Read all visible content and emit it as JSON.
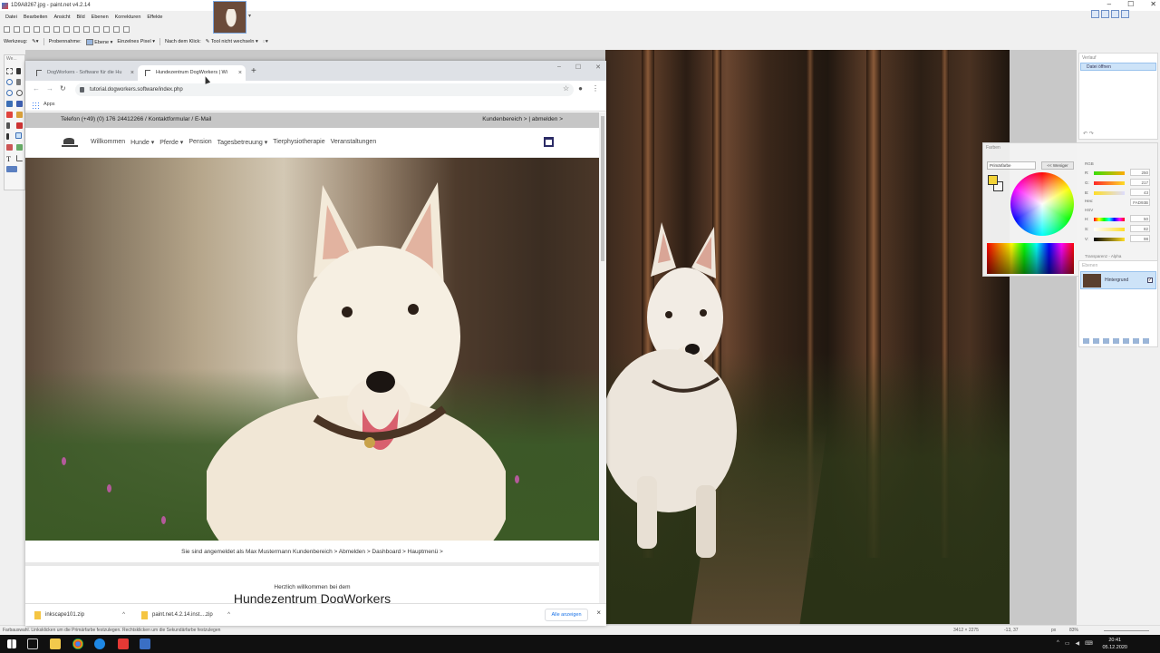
{
  "pn": {
    "title": "1D9A8267.jpg - paint.net v4.2.14",
    "menu": [
      "Datei",
      "Bearbeiten",
      "Ansicht",
      "Bild",
      "Ebenen",
      "Korrekturen",
      "Effekte"
    ],
    "toolopts": {
      "tool": "Werkzeug:",
      "sampling": "Probennahme:",
      "layer": "Ebene",
      "pixel": "Einzelnes Pixel",
      "after_click": "Nach dem Klick:",
      "tool_switch": "Tool nicht wechseln"
    },
    "tools_label": "We...",
    "history": {
      "title": "Verlauf",
      "item": "Datei öffnen"
    },
    "colors": {
      "title": "Farben",
      "primary_select": "Primärfarbe",
      "less_button": "<< Weniger",
      "primary_color": "#FAD93B",
      "rgb_label": "RGB",
      "r_label": "R:",
      "r_value": "250",
      "g_label": "G:",
      "g_value": "217",
      "b_label": "B:",
      "b_value": "43",
      "hex_label": "Hex:",
      "hex_value": "FAD93B",
      "hsv_label": "HSV",
      "h_label": "H:",
      "h_value": "50",
      "s_label": "S:",
      "s_value": "82",
      "v_label": "V:",
      "v_value": "98",
      "alpha_label": "Transparenz - Alpha"
    },
    "layers": {
      "title": "Ebenen",
      "layer_name": "Hintergrund",
      "layer_check": "✓"
    },
    "status": {
      "hint": "Farbauswahl. Linksklicken um die Primärfarbe festzulegen. Rechtsklicken um die Sekundärfarbe festzulegen",
      "size": "3412 × 2275",
      "coords": "-13, 37",
      "units": "px",
      "zoom": "83%"
    }
  },
  "browser": {
    "tab1": "DogWorkers - Software für die Hu",
    "tab2": "Hundezentrum DogWorkers | Wi",
    "new_tab": "+",
    "url": "tutorial.dogworkers.software/index.php",
    "apps": "Apps",
    "downloads": [
      {
        "name": "inkscape101.zip"
      },
      {
        "name": "paint.net.4.2.14.inst....zip"
      }
    ],
    "show_all": "Alle anzeigen"
  },
  "site": {
    "contact": "Telefon (+49) (0) 176 24412266 / Kontaktformular / E-Mail",
    "account": "Kundenbereich > | abmelden >",
    "nav": [
      "Willkommen",
      "Hunde ▾",
      "Pferde ▾",
      "Pension",
      "Tagesbetreuung ▾",
      "Tierphysiotherapie",
      "Veranstaltungen"
    ],
    "login_bar": "Sie sind angemeldet als Max Mustermann Kundenbereich > Abmelden > Dashboard > Hauptmenü >",
    "welcome": "Herzlich willkommen bei dem",
    "heading": "Hundezentrum DogWorkers"
  },
  "taskbar": {
    "time": "20:41",
    "date": "05.12.2020"
  }
}
